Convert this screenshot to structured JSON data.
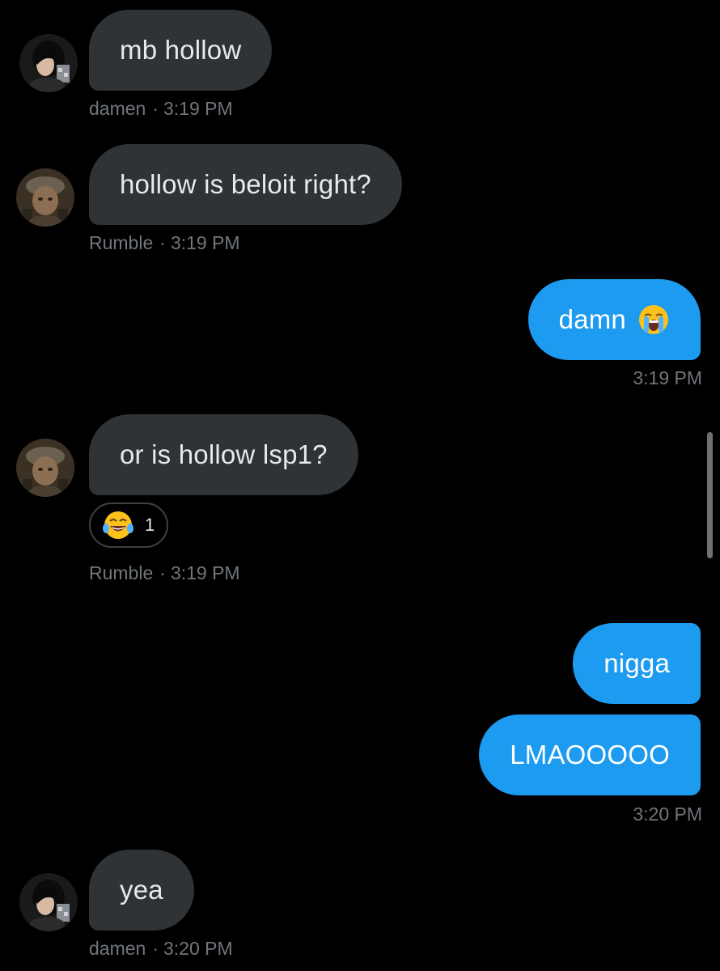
{
  "messages": [
    {
      "text": "mb hollow",
      "sender": "damen",
      "time": "3:19 PM"
    },
    {
      "text": "hollow is beloit right?",
      "sender": "Rumble",
      "time": "3:19 PM"
    },
    {
      "text": "damn",
      "emoji": "loudly-crying-face",
      "time": "3:19 PM"
    },
    {
      "text": "or is hollow lsp1?",
      "sender": "Rumble",
      "time": "3:19 PM",
      "reaction": {
        "emoji": "face-with-tears-of-joy",
        "count": "1"
      }
    },
    {
      "text": "nigga"
    },
    {
      "text": "LMAOOOOO",
      "time": "3:20 PM"
    },
    {
      "text": "yea",
      "sender": "damen",
      "time": "3:20 PM"
    }
  ],
  "meta_separator": "·",
  "colors": {
    "background": "#000000",
    "incoming_bubble": "#2f3336",
    "outgoing_bubble": "#1d9bf0",
    "meta_text": "#71767b"
  }
}
